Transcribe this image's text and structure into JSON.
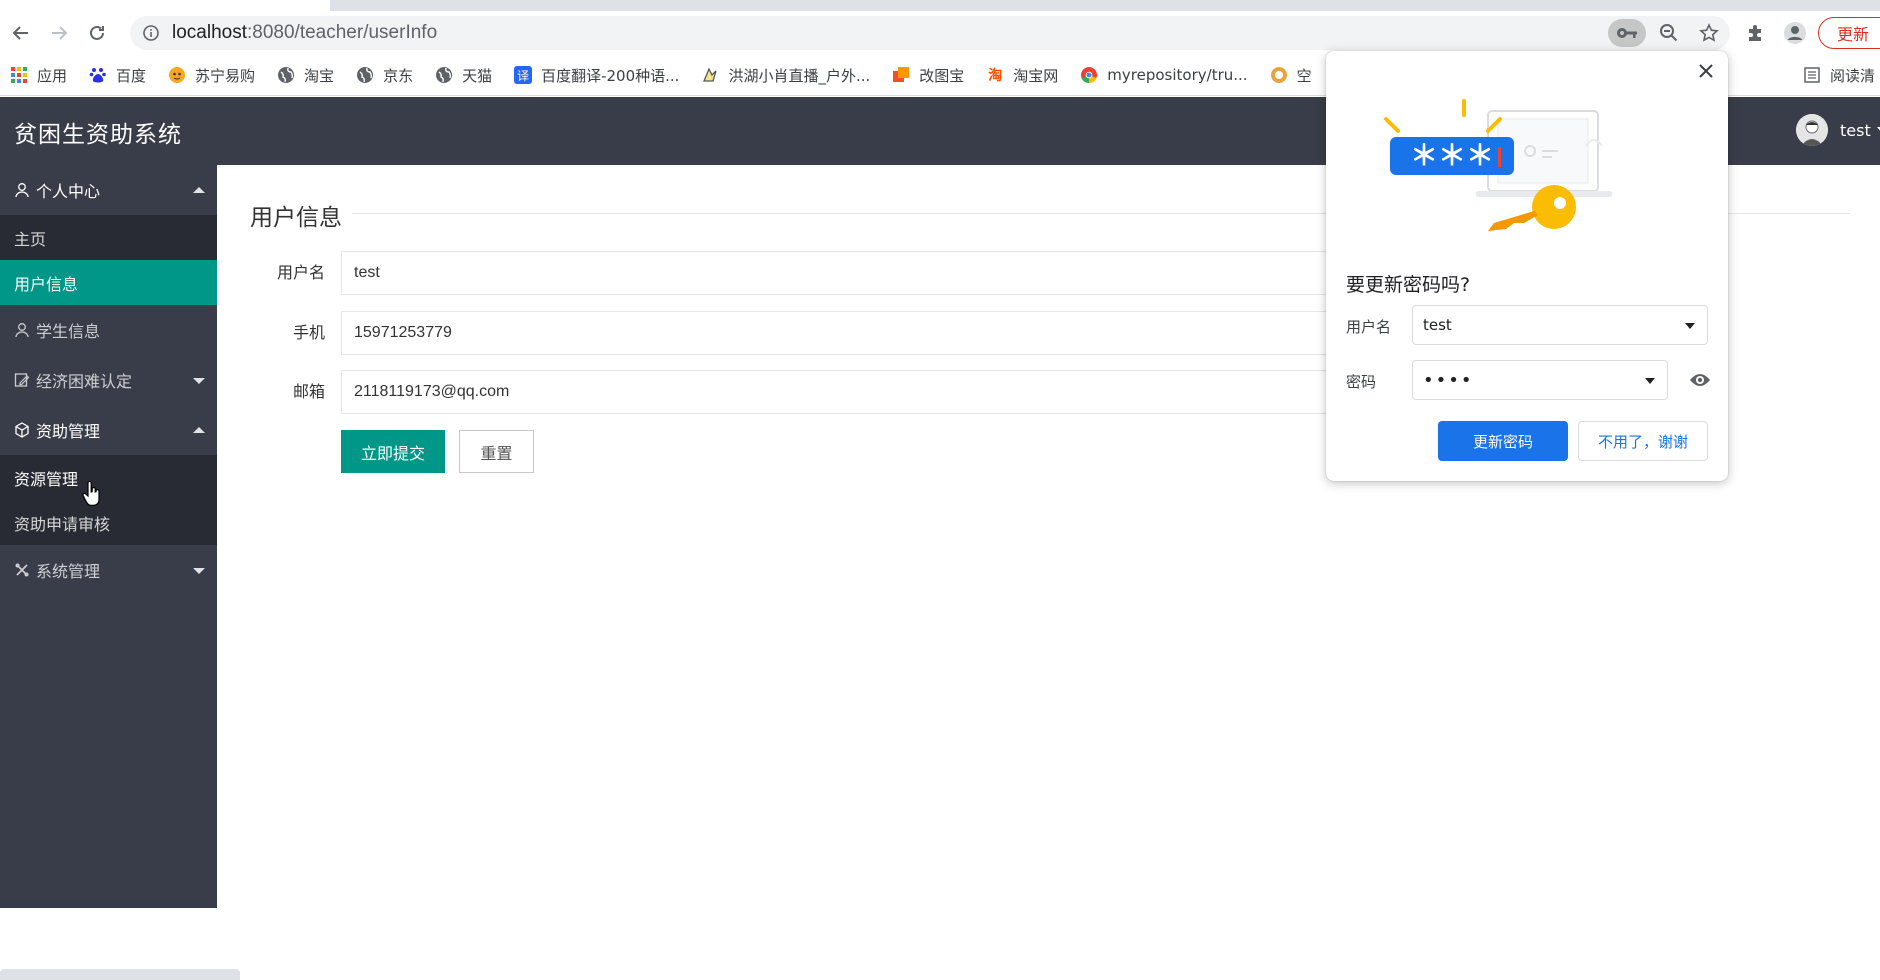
{
  "browser": {
    "url_host": "localhost",
    "url_path": ":8080/teacher/userInfo",
    "update_label": "更新",
    "bookmarks": [
      {
        "label": "应用",
        "icon": "apps-grid-icon"
      },
      {
        "label": "百度",
        "icon": "baidu-icon"
      },
      {
        "label": "苏宁易购",
        "icon": "suning-icon"
      },
      {
        "label": "淘宝",
        "icon": "globe-icon"
      },
      {
        "label": "京东",
        "icon": "globe-icon"
      },
      {
        "label": "天猫",
        "icon": "globe-icon"
      },
      {
        "label": "百度翻译-200种语...",
        "icon": "translate-icon"
      },
      {
        "label": "洪湖小肖直播_户外...",
        "icon": "live-icon"
      },
      {
        "label": "改图宝",
        "icon": "gaitubao-icon"
      },
      {
        "label": "淘宝网",
        "icon": "taobao-icon"
      },
      {
        "label": "myrepository/tru...",
        "icon": "chrome-icon"
      },
      {
        "label": "空",
        "icon": "bookmark-icon"
      }
    ],
    "reading_list_label": "阅读清"
  },
  "app": {
    "title": "贫困生资助系统",
    "user_name": "test"
  },
  "sidebar": {
    "groups": [
      {
        "label": "个人中心",
        "expanded": true,
        "items": [
          "主页",
          "用户信息"
        ]
      },
      {
        "label": "学生信息"
      },
      {
        "label": "经济困难认定",
        "expanded": false
      },
      {
        "label": "资助管理",
        "expanded": true,
        "items": [
          "资源管理",
          "资助申请审核"
        ]
      },
      {
        "label": "系统管理",
        "expanded": false
      }
    ],
    "active_item": "用户信息"
  },
  "form": {
    "legend": "用户信息",
    "fields": [
      {
        "label": "用户名",
        "value": "test"
      },
      {
        "label": "手机",
        "value": "15971253779"
      },
      {
        "label": "邮箱",
        "value": "2118119173@qq.com"
      }
    ],
    "submit_label": "立即提交",
    "reset_label": "重置"
  },
  "password_popup": {
    "title": "要更新密码吗?",
    "username_label": "用户名",
    "username_value": "test",
    "password_label": "密码",
    "password_value": "••••",
    "illustration_text": "＊＊＊",
    "update_button": "更新密码",
    "decline_button": "不用了，谢谢"
  },
  "colors": {
    "header_bg": "#393d49",
    "sidebar_sub_bg": "#282b33",
    "accent": "#009688",
    "chrome_blue": "#1a73e8"
  }
}
